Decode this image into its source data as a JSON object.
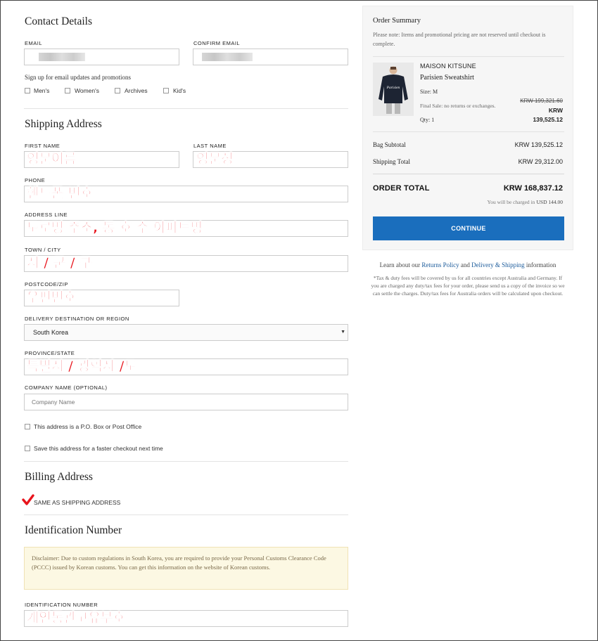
{
  "contact": {
    "title": "Contact Details",
    "email_label": "EMAIL",
    "confirm_email_label": "CONFIRM EMAIL",
    "signup_text": "Sign up for email updates and promotions",
    "options": [
      "Men's",
      "Women's",
      "Archives",
      "Kid's"
    ]
  },
  "shipping": {
    "title": "Shipping Address",
    "first_name_label": "FIRST NAME",
    "first_name_note": "영문이름",
    "last_name_label": "LAST NAME",
    "last_name_note": "영문성",
    "phone_label": "PHONE",
    "phone_note": "핸드폰 번호",
    "address_label": "ADDRESS LINE",
    "address_note": "도로명 주소, 동 호 수 아파트명",
    "town_label": "TOWN / CITY",
    "town_note": "시 / 군 / 구",
    "postcode_label": "POSTCODE/ZIP",
    "postcode_note": "우편번호",
    "destination_label": "DELIVERY DESTINATION OR REGION",
    "destination_value": "South Korea",
    "province_label": "PROVINCE/STATE",
    "province_note": "특별시 / 광역시 /도",
    "company_label": "COMPANY NAME (OPTIONAL)",
    "company_placeholder": "Company Name",
    "po_box_label": "This address is a P.O. Box or Post Office",
    "save_label": "Save this address for a faster checkout next time"
  },
  "billing": {
    "title": "Billing Address",
    "same_label": "SAME AS SHIPPING ADDRESS"
  },
  "identification": {
    "title": "Identification Number",
    "disclaimer": "Disclaimer: Due to custom regulations in South Korea, you are required to provide your Personal Customs Clearance Code (PCCC) issued by Korean customs. You can get this information on the website of Korean customs.",
    "field_label": "IDENTIFICATION NUMBER",
    "field_note": "개인통관고유부호"
  },
  "summary": {
    "title": "Order Summary",
    "note": "Please note: Items and promotional pricing are not reserved until checkout is complete.",
    "item": {
      "brand": "MAISON KITSUNE",
      "name": "Parisien Sweatshirt",
      "size": "Size: M",
      "final_sale": "Final Sale: no returns or exchanges.",
      "qty": "Qty: 1",
      "old_price": "KRW 199,321.60",
      "currency": "KRW",
      "price": "139,525.12",
      "print_text": "Parisien"
    },
    "subtotal_label": "Bag Subtotal",
    "subtotal_value": "KRW 139,525.12",
    "shipping_label": "Shipping Total",
    "shipping_value": "KRW 29,312.00",
    "total_label": "ORDER TOTAL",
    "total_value": "KRW 168,837.12",
    "charged_label": "You will be charged in",
    "charged_value": "USD 144.00",
    "continue_label": "CONTINUE"
  },
  "footer": {
    "learn_prefix": "Learn about our",
    "returns_link": "Returns Policy",
    "and": "and",
    "delivery_link": "Delivery & Shipping",
    "learn_suffix": "information",
    "tax_note": "*Tax & duty fees will be covered by us for all countries except Australia and Germany. If you are charged any duty/tax fees for your order, please send us a copy of the invoice so we can settle the charges. Duty/tax fees for Australia orders will be calculated upon checkout."
  },
  "colors": {
    "accent_button": "#1a6ebd",
    "annotation_red": "#e8141c",
    "link": "#1a5a9a",
    "disclaimer_bg": "#fcf8e3"
  }
}
